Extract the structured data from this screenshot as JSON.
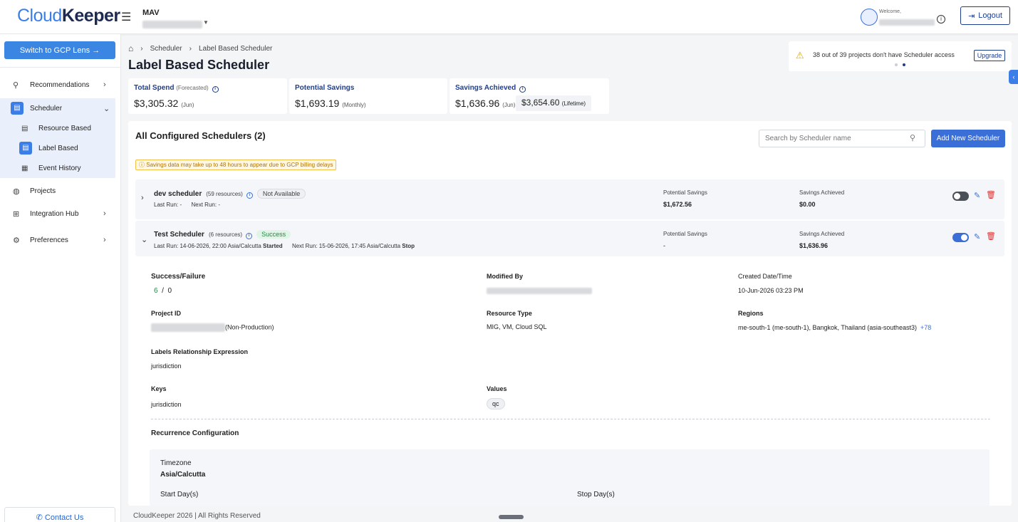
{
  "brand": {
    "logo_prefix": "Cloud",
    "logo_suffix": "Keeper"
  },
  "header": {
    "org_name": "MAV",
    "welcome_label": "Welcome,",
    "logout_label": "Logout"
  },
  "sidebar": {
    "switch_button": "Switch to GCP Lens",
    "items": [
      {
        "label": "Recommendations",
        "icon": "bulb-icon"
      },
      {
        "label": "Scheduler",
        "icon": "scheduler-icon"
      },
      {
        "label": "Projects",
        "icon": "projects-icon"
      },
      {
        "label": "Integration Hub",
        "icon": "integration-icon"
      },
      {
        "label": "Preferences",
        "icon": "preferences-icon"
      }
    ],
    "sub_items": [
      {
        "label": "Resource Based"
      },
      {
        "label": "Label Based"
      },
      {
        "label": "Event History"
      }
    ],
    "contact_label": "Contact Us"
  },
  "breadcrumb": [
    "Scheduler",
    "Label Based Scheduler"
  ],
  "page_title": "Label Based Scheduler",
  "notice": {
    "text": "38 out of 39 projects don't have Scheduler access",
    "button": "Upgrade"
  },
  "kpis": {
    "total_spend": {
      "title": "Total Spend",
      "qualifier": "(Forecasted)",
      "value": "$3,305.32",
      "period": "(Jun)"
    },
    "potential_savings": {
      "title": "Potential Savings",
      "value": "$1,693.19",
      "period": "(Monthly)"
    },
    "savings_achieved": {
      "title": "Savings Achieved",
      "value": "$1,636.96",
      "period": "(Jun)",
      "lifetime_value": "$3,654.60",
      "lifetime_label": "(Lifetime)"
    }
  },
  "schedulers": {
    "title": "All Configured Schedulers (2)",
    "search_placeholder": "Search by Scheduler name",
    "add_button": "Add New Scheduler",
    "delay_note": "Savings data may take up to 48 hours to appear due to GCP billing delays",
    "col_potential": "Potential Savings",
    "col_achieved": "Savings Achieved",
    "rows": [
      {
        "name": "dev scheduler",
        "resources": "(59 resources)",
        "status": "Not Available",
        "last_run_label": "Last Run:",
        "last_run": "-",
        "next_run_label": "Next Run:",
        "next_run": "-",
        "potential": "$1,672.56",
        "achieved": "$0.00",
        "enabled": false
      },
      {
        "name": "Test Scheduler",
        "resources": "(6 resources)",
        "status": "Success",
        "last_run_label": "Last Run:",
        "last_run": "14-06-2026, 22:00 Asia/Calcutta",
        "last_action": "Started",
        "next_run_label": "Next Run:",
        "next_run": "15-06-2026, 17:45 Asia/Calcutta",
        "next_action": "Stop",
        "potential": "-",
        "achieved": "$1,636.96",
        "enabled": true
      }
    ]
  },
  "detail": {
    "success_failure_label": "Success/Failure",
    "success_count": "6",
    "separator": "/",
    "failure_count": "0",
    "modified_by_label": "Modified By",
    "created_label": "Created Date/Time",
    "created_value": "10-Jun-2026 03:23 PM",
    "project_id_label": "Project ID",
    "project_env": "(Non-Production)",
    "resource_type_label": "Resource Type",
    "resource_type_value": "MIG, VM, Cloud SQL",
    "regions_label": "Regions",
    "regions_value": "me-south-1 (me-south-1), Bangkok, Thailand (asia-southeast3)",
    "regions_more": "+78",
    "labels_expr_label": "Labels Relationship Expression",
    "labels_expr_value": "jurisdiction",
    "keys_label": "Keys",
    "keys_value": "jurisdiction",
    "values_label": "Values",
    "values_value": "qc",
    "recurrence_label": "Recurrence Configuration",
    "timezone_label": "Timezone",
    "timezone_value": "Asia/Calcutta",
    "start_days_label": "Start Day(s)",
    "stop_days_label": "Stop Day(s)"
  },
  "footer": {
    "text": "CloudKeeper 2026 | All Rights Reserved"
  },
  "colors": {
    "primary": "#3b6fd8",
    "brand_dark": "#1d3d8f",
    "success": "#1f8a46",
    "danger": "#d8302f"
  }
}
